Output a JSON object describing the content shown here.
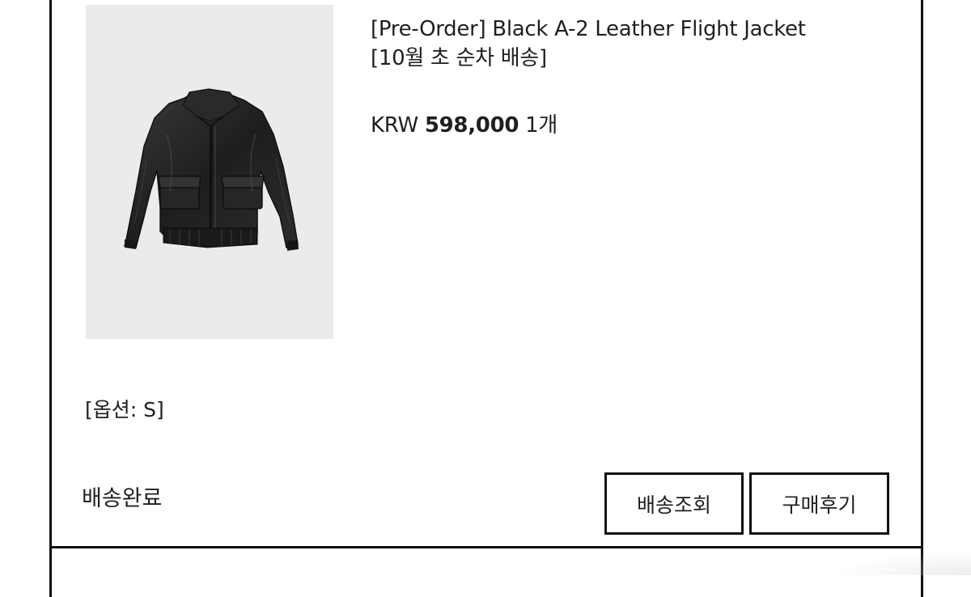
{
  "order": {
    "product": {
      "title_line1": "[Pre-Order] Black A-2 Leather Flight Jacket",
      "title_line2": "[10월 초 순차 배송]",
      "image_icon": "leather-jacket-icon",
      "currency": "KRW",
      "price": "598,000",
      "quantity": "1개"
    },
    "option": "[옵션: S]",
    "status": "배송완료",
    "buttons": {
      "track_label": "배송조회",
      "review_label": "구매후기"
    }
  },
  "colors": {
    "border": "#111111",
    "image_bg": "#ebebe9",
    "text": "#1f1f1f"
  }
}
